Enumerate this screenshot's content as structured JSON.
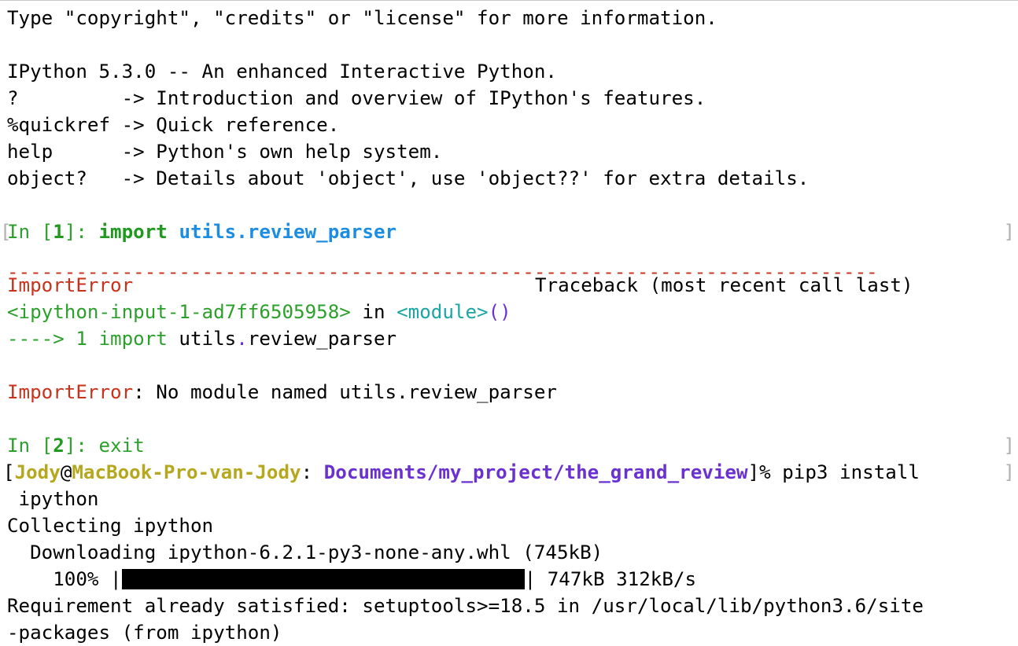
{
  "banner": {
    "copyright_line": "Type \"copyright\", \"credits\" or \"license\" for more information.",
    "version_line": "IPython 5.3.0 -- An enhanced Interactive Python.",
    "help_lines": [
      {
        "cmd": "?         ",
        "desc": "-> Introduction and overview of IPython's features."
      },
      {
        "cmd": "%quickref ",
        "desc": "-> Quick reference."
      },
      {
        "cmd": "help      ",
        "desc": "-> Python's own help system."
      },
      {
        "cmd": "object?   ",
        "desc": "-> Details about 'object', use 'object??' for extra details."
      }
    ]
  },
  "cell1": {
    "prompt_prefix": "In [",
    "prompt_num": "1",
    "prompt_suffix": "]: ",
    "keyword": "import",
    "module": "utils.review_parser"
  },
  "traceback": {
    "dashes": "----------------------------------------------------------------------------",
    "error_name": "ImportError",
    "traceback_header": "Traceback (most recent call last)",
    "input_ref": "<ipython-input-1-ad7ff6505958>",
    "in_word": " in ",
    "module_ref": "<module>",
    "parens": "()",
    "arrow": "----> 1 ",
    "code_keyword": "import",
    "code_pre": " utils",
    "code_dot": ".",
    "code_post": "review_parser",
    "error_message": ": No module named utils.review_parser"
  },
  "cell2": {
    "prompt_prefix": "In [",
    "prompt_num": "2",
    "prompt_suffix": "]: ",
    "command": "exit"
  },
  "shell": {
    "open_bracket": "[",
    "user": "Jody",
    "at": "@",
    "host": "MacBook-Pro-van-Jody",
    "colon": ": ",
    "path": "Documents/my_project/the_grand_review",
    "close": "]% ",
    "command": "pip3 install",
    "command_wrap": " ipython"
  },
  "pip_output": {
    "collecting": "Collecting ipython",
    "downloading": "  Downloading ipython-6.2.1-py3-none-any.whl (745kB)",
    "progress_percent": "    100% |",
    "progress_fraction": 1.0,
    "progress_suffix": "| 747kB 312kB/s",
    "requirement_line1": "Requirement already satisfied: setuptools>=18.5 in /usr/local/lib/python3.6/site",
    "requirement_line2": "-packages (from ipython)"
  },
  "colors": {
    "prompt_green": "#2ba02b",
    "keyword_green": "#1f9a1f",
    "module_blue": "#1c8de0",
    "error_red": "#c8321c",
    "cyan": "#1aa6a6",
    "purple": "#6a30d0",
    "user_yellow": "#b6a81e"
  }
}
